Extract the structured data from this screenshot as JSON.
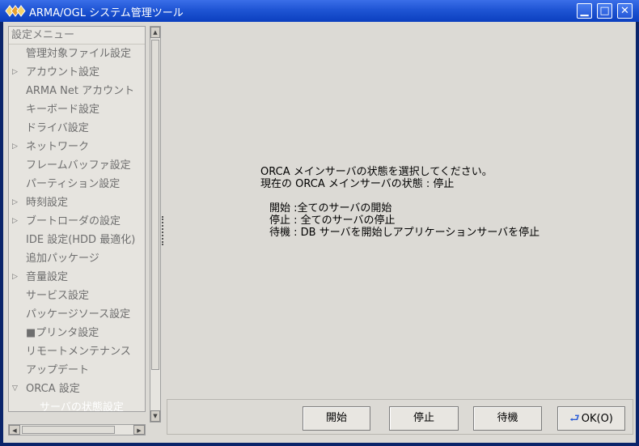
{
  "window": {
    "title": "ARMA/OGL システム管理ツール"
  },
  "titlebar_buttons": {
    "minimize": "▁",
    "maximize": "□",
    "close": "✕"
  },
  "sidebar": {
    "header": "設定メニュー",
    "items": [
      {
        "label": "管理対象ファイル設定",
        "expander": ""
      },
      {
        "label": "アカウント設定",
        "expander": "▷"
      },
      {
        "label": "ARMA Net アカウント",
        "expander": ""
      },
      {
        "label": "キーボード設定",
        "expander": ""
      },
      {
        "label": "ドライバ設定",
        "expander": ""
      },
      {
        "label": "ネットワーク",
        "expander": "▷"
      },
      {
        "label": "フレームバッファ設定",
        "expander": ""
      },
      {
        "label": "パーティション設定",
        "expander": ""
      },
      {
        "label": "時刻設定",
        "expander": "▷"
      },
      {
        "label": "ブートローダの設定",
        "expander": "▷"
      },
      {
        "label": "IDE 設定(HDD 最適化)",
        "expander": ""
      },
      {
        "label": "追加パッケージ",
        "expander": ""
      },
      {
        "label": "音量設定",
        "expander": "▷"
      },
      {
        "label": "サービス設定",
        "expander": ""
      },
      {
        "label": "パッケージソース設定",
        "expander": ""
      },
      {
        "label": "■プリンタ設定",
        "expander": ""
      },
      {
        "label": "リモートメンテナンス",
        "expander": ""
      },
      {
        "label": "アップデート",
        "expander": ""
      },
      {
        "label": "ORCA 設定",
        "expander": "▽"
      }
    ],
    "child_item": "サーバの状態設定"
  },
  "scroll": {
    "up": "▲",
    "down": "▼",
    "left": "◀",
    "right": "▶"
  },
  "content": {
    "line1": "ORCA メインサーバの状態を選択してください。",
    "line2": "現在の ORCA メインサーバの状態 : 停止",
    "line3": "開始 :全てのサーバの開始",
    "line4": "停止 : 全てのサーバの停止",
    "line5": "待機 : DB サーバを開始しアプリケーションサーバを停止"
  },
  "buttons": {
    "start": "開始",
    "stop": "停止",
    "standby": "待機",
    "ok": "OK(O)"
  }
}
